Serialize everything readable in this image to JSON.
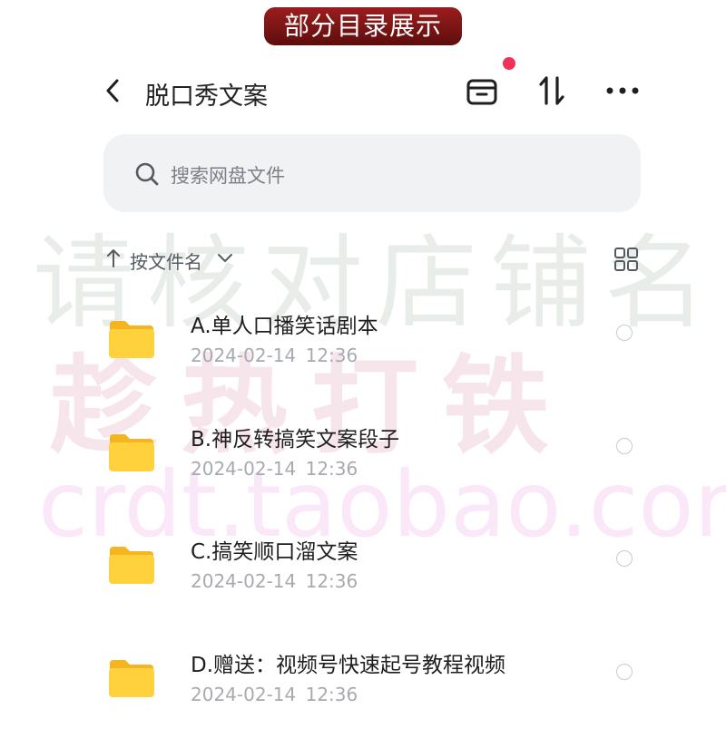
{
  "banner": {
    "text": "部分目录展示"
  },
  "header": {
    "title": "脱口秀文案"
  },
  "search": {
    "placeholder": "搜索网盘文件"
  },
  "sortbar": {
    "label": "按文件名"
  },
  "watermarks": {
    "line1": "请核对店铺名",
    "line2": "趁热打铁",
    "line3": "crdt.taobao.com"
  },
  "files": [
    {
      "name": "A.单人口播笑话剧本",
      "date": "2024-02-14  12:36"
    },
    {
      "name": "B.神反转搞笑文案段子",
      "date": "2024-02-14  12:36"
    },
    {
      "name": "C.搞笑顺口溜文案",
      "date": "2024-02-14  12:36"
    },
    {
      "name": "D.赠送：视频号快速起号教程视频",
      "date": "2024-02-14  12:36"
    }
  ],
  "colors": {
    "accent_dot": "#f0315b",
    "folder": "#ffd23d",
    "banner": "#7a1414"
  }
}
